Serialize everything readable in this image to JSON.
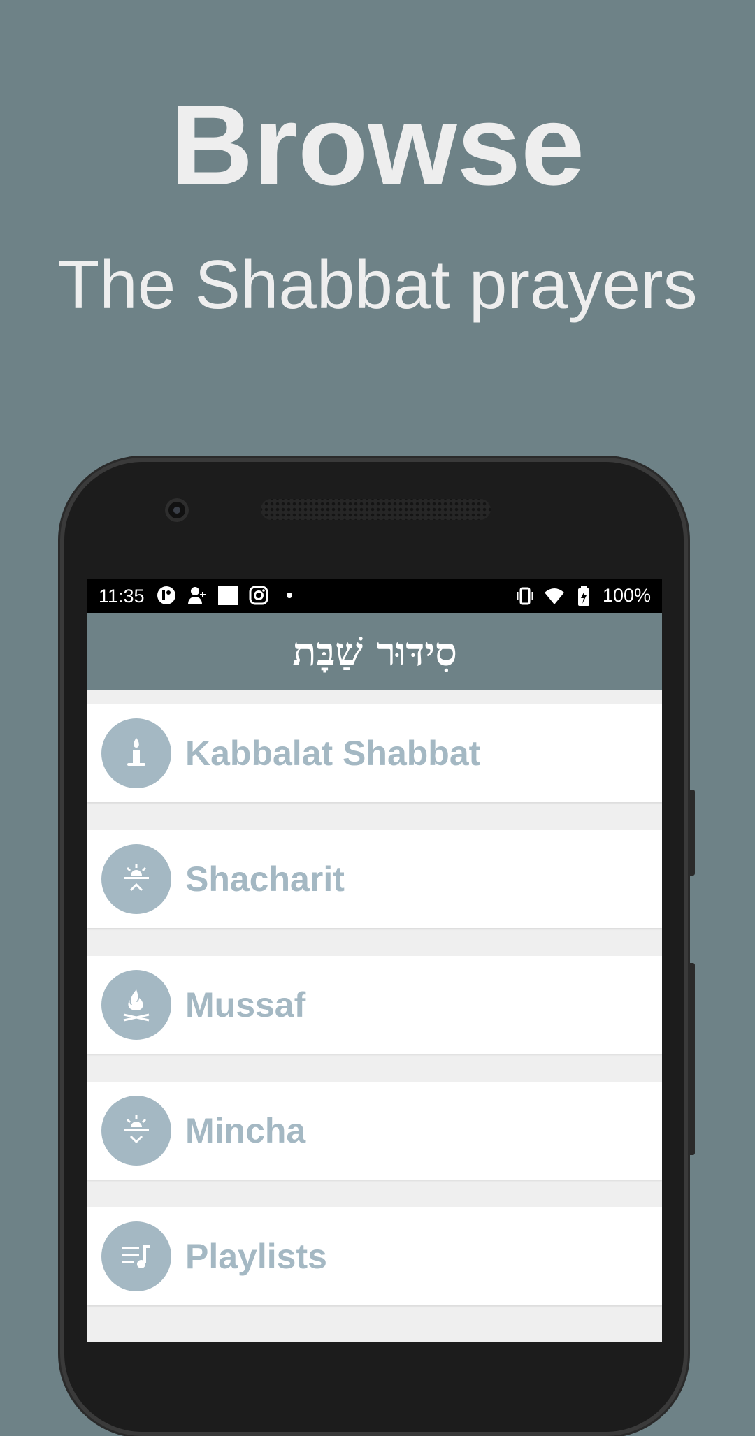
{
  "promo": {
    "title": "Browse",
    "subtitle": "The Shabbat prayers"
  },
  "status_bar": {
    "time": "11:35",
    "battery": "100%",
    "left_icons": [
      "app-icon",
      "add-contact-icon",
      "square-icon",
      "instagram-icon",
      "dot-icon"
    ],
    "right_icons": [
      "vibrate-icon",
      "wifi-icon",
      "battery-charging-icon"
    ]
  },
  "app_bar": {
    "title": "סִידּוּר שַׁבָּת"
  },
  "menu": {
    "items": [
      {
        "label": "Kabbalat Shabbat",
        "icon": "candle-icon"
      },
      {
        "label": "Shacharit",
        "icon": "sunrise-icon"
      },
      {
        "label": "Mussaf",
        "icon": "fire-icon"
      },
      {
        "label": "Mincha",
        "icon": "sunset-icon"
      },
      {
        "label": "Playlists",
        "icon": "playlist-icon"
      }
    ]
  },
  "colors": {
    "background": "#6e8287",
    "app_bar": "#6e8287",
    "accent_muted": "#a4b8c3",
    "list_bg": "#efefef"
  }
}
